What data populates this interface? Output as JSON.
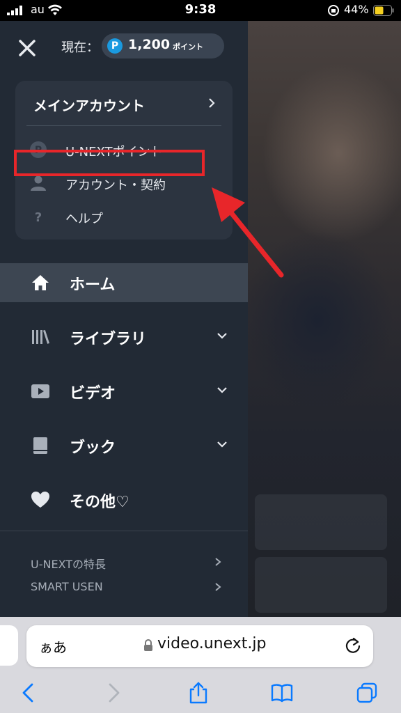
{
  "status_bar": {
    "carrier": "au",
    "time": "9:38",
    "battery_percent": "44%"
  },
  "drawer": {
    "points_label": "現在：",
    "points_badge": "P",
    "points_amount": "1,200",
    "points_unit": "ポイント",
    "account": {
      "title": "メインアカウント",
      "items": [
        {
          "label": "U-NEXTポイント",
          "icon": "points-icon"
        },
        {
          "label": "アカウント・契約",
          "icon": "person-icon"
        },
        {
          "label": "ヘルプ",
          "icon": "help-icon"
        }
      ]
    },
    "nav": [
      {
        "label": "ホーム",
        "icon": "home-icon",
        "active": true
      },
      {
        "label": "ライブラリ",
        "icon": "library-icon"
      },
      {
        "label": "ビデオ",
        "icon": "video-icon"
      },
      {
        "label": "ブック",
        "icon": "book-icon"
      },
      {
        "label": "その他♡",
        "icon": "heart-icon"
      }
    ],
    "footer_links": [
      {
        "label": "U-NEXTの特長"
      },
      {
        "label": "SMART USEN"
      }
    ]
  },
  "browser": {
    "text_size_button": "ぁあ",
    "url": "video.unext.jp"
  },
  "colors": {
    "drawer_bg": "#222a35",
    "highlight_red": "#e8262a",
    "points_blue": "#1a9ae0",
    "ios_blue": "#0a7aff"
  }
}
